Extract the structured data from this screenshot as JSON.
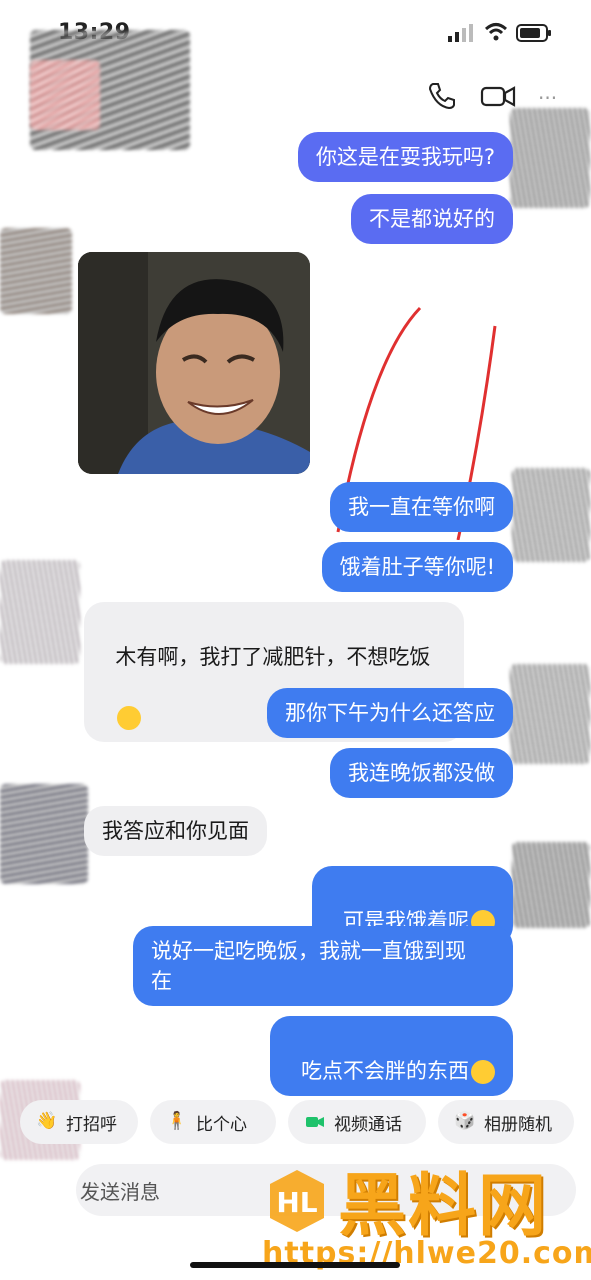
{
  "status_bar": {
    "time": "13:29"
  },
  "messages": [
    {
      "side": "out",
      "text": "你这是在耍我玩吗?"
    },
    {
      "side": "out",
      "text": "不是都说好的"
    },
    {
      "side": "out",
      "text": "我一直在等你啊"
    },
    {
      "side": "out",
      "text": "饿着肚子等你呢!"
    },
    {
      "side": "in",
      "text": "木有啊，我打了减肥针，不想吃饭"
    },
    {
      "side": "out",
      "text": "那你下午为什么还答应"
    },
    {
      "side": "out",
      "text": "我连晚饭都没做"
    },
    {
      "side": "in",
      "text": "我答应和你见面"
    },
    {
      "side": "out",
      "text": "可是我饿着呢"
    },
    {
      "side": "out",
      "text": "说好一起吃晚饭，我就一直饿到现\n在"
    },
    {
      "side": "out",
      "text": "吃点不会胖的东西"
    }
  ],
  "quick_actions": [
    {
      "label": "打招呼",
      "icon": "wave-icon"
    },
    {
      "label": "比个心",
      "icon": "heart-gesture-icon"
    },
    {
      "label": "视频通话",
      "icon": "video-call-icon"
    },
    {
      "label": "相册随机",
      "icon": "dice-icon"
    }
  ],
  "input": {
    "placeholder": "发送消息"
  },
  "watermark": {
    "title": "黑料网",
    "url": "https://hlwe20.com"
  },
  "colors": {
    "outgoing": "#3f7cf0",
    "incoming": "#efeff1",
    "watermark": "#f7a51a"
  }
}
